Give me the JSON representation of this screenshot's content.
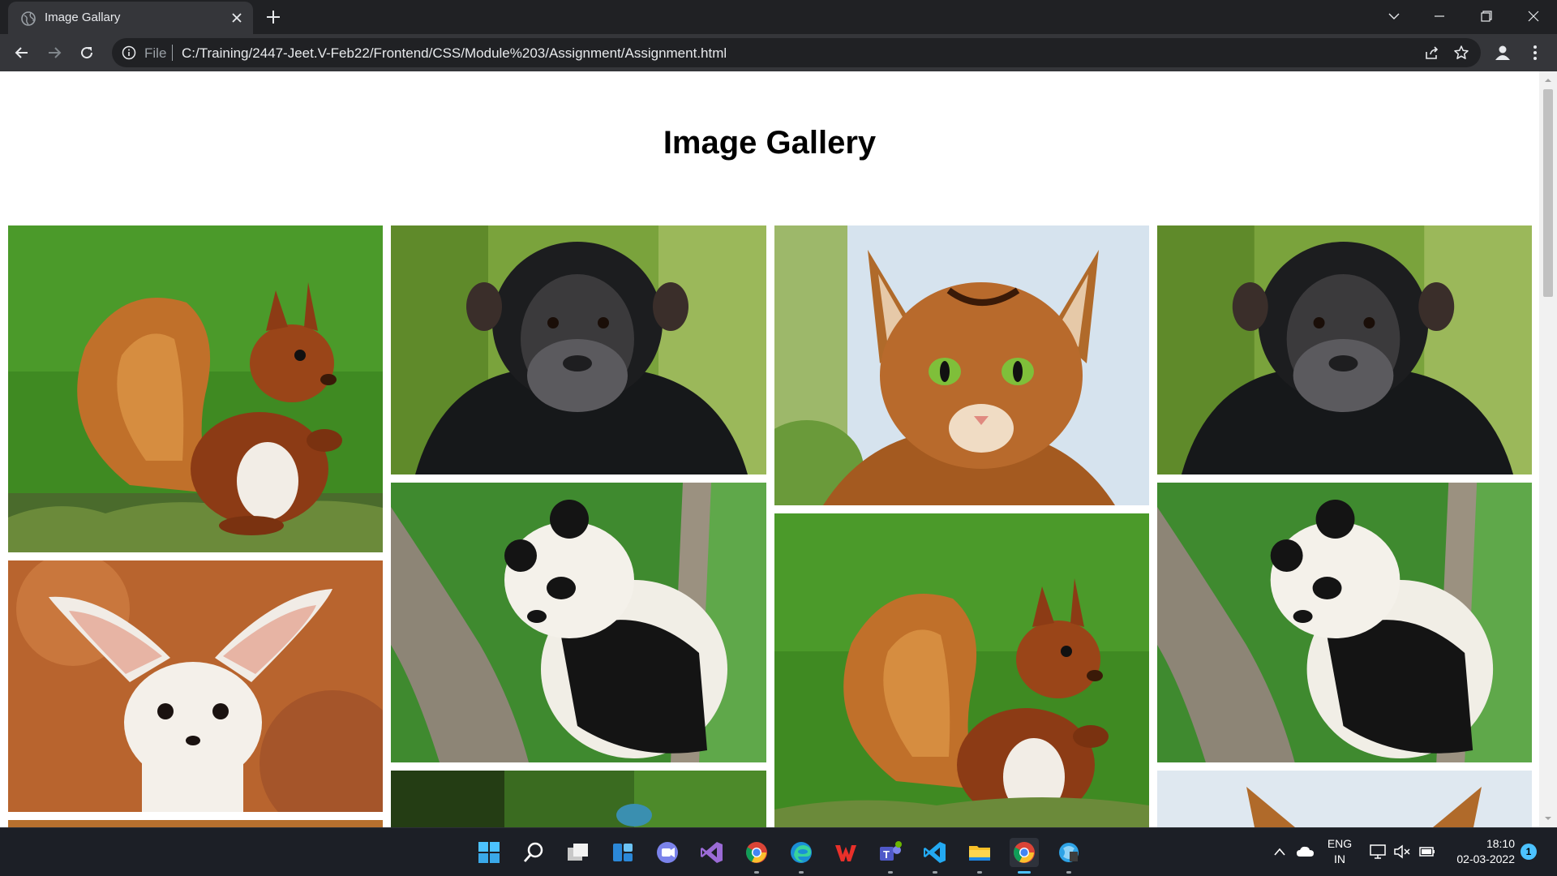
{
  "browser": {
    "tab_title": "Image Gallary",
    "url_scheme_label": "File",
    "url": "C:/Training/2447-Jeet.V-Feb22/Frontend/CSS/Module%203/Assignment/Assignment.html"
  },
  "page": {
    "heading": "Image Gallery",
    "images": [
      {
        "subject": "squirrel"
      },
      {
        "subject": "fennec fox"
      },
      {
        "subject": "chimpanzee"
      },
      {
        "subject": "panda"
      },
      {
        "subject": "cat"
      },
      {
        "subject": "squirrel"
      },
      {
        "subject": "chimpanzee"
      },
      {
        "subject": "panda"
      }
    ]
  },
  "taskbar": {
    "apps": [
      "start-icon",
      "search-icon",
      "task-view-icon",
      "widgets-icon",
      "teams-chat-icon",
      "visual-studio-icon",
      "chrome-icon",
      "edge-icon",
      "wps-office-icon",
      "teams-icon",
      "vscode-icon",
      "file-explorer-icon",
      "chrome-icon",
      "control-panel-icon"
    ],
    "language_line1": "ENG",
    "language_line2": "IN",
    "time": "18:10",
    "date": "02-03-2022",
    "notification_count": "1"
  },
  "colors": {
    "titlebar": "#202124",
    "toolbar": "#35363a",
    "taskbar": "#1c1f26",
    "accent": "#4cc2ff"
  }
}
